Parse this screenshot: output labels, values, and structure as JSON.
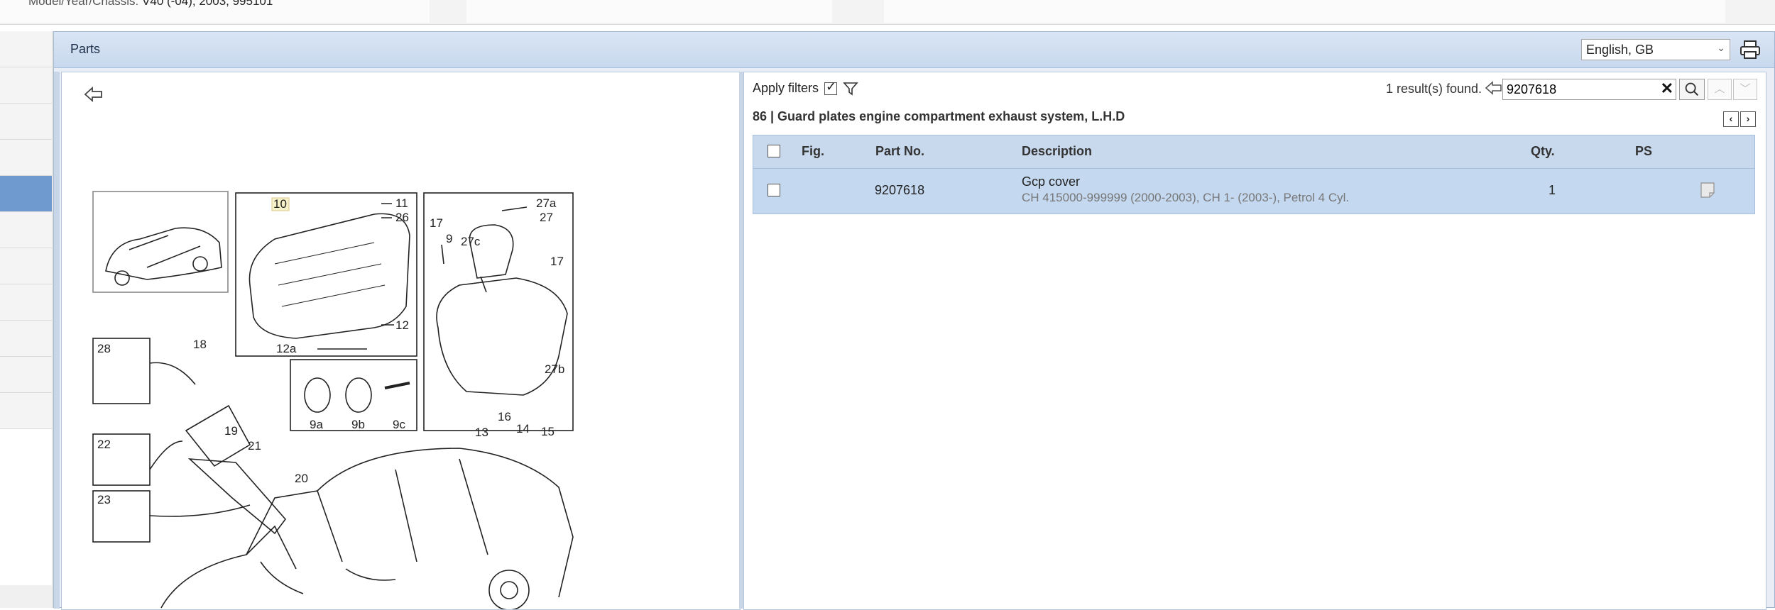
{
  "topbar": {
    "model_label": "Model/Year/Chassis:",
    "model_value": "V40 (-04), 2003, 995101"
  },
  "panel": {
    "title": "Parts",
    "language": "English, GB"
  },
  "filters": {
    "apply_label": "Apply filters",
    "apply_checked": true
  },
  "search": {
    "results_text": "1 result(s) found.",
    "query": "9207618"
  },
  "group": {
    "title": "86  |  Guard plates engine compartment exhaust system, L.H.D"
  },
  "table": {
    "headers": {
      "fig": "Fig.",
      "part_no": "Part No.",
      "description": "Description",
      "qty": "Qty.",
      "ps": "PS"
    },
    "rows": [
      {
        "fig": "",
        "part_no": "9207618",
        "description": "Gcp cover",
        "detail": "CH 415000-999999 (2000-2003), CH 1- (2003-), Petrol 4 Cyl.",
        "qty": "1"
      }
    ]
  },
  "diagram": {
    "labels": [
      "10",
      "11",
      "26",
      "12",
      "12a",
      "17",
      "9",
      "27c",
      "27a",
      "27",
      "17",
      "27b",
      "16",
      "14",
      "13",
      "15",
      "28",
      "18",
      "19",
      "21",
      "20",
      "22",
      "23",
      "9a",
      "9b",
      "9c"
    ]
  },
  "icons": {
    "back": "back-arrow-icon",
    "filter": "funnel-icon",
    "search": "search-icon",
    "print": "printer-icon",
    "clear": "close-icon",
    "ps": "note-icon"
  }
}
